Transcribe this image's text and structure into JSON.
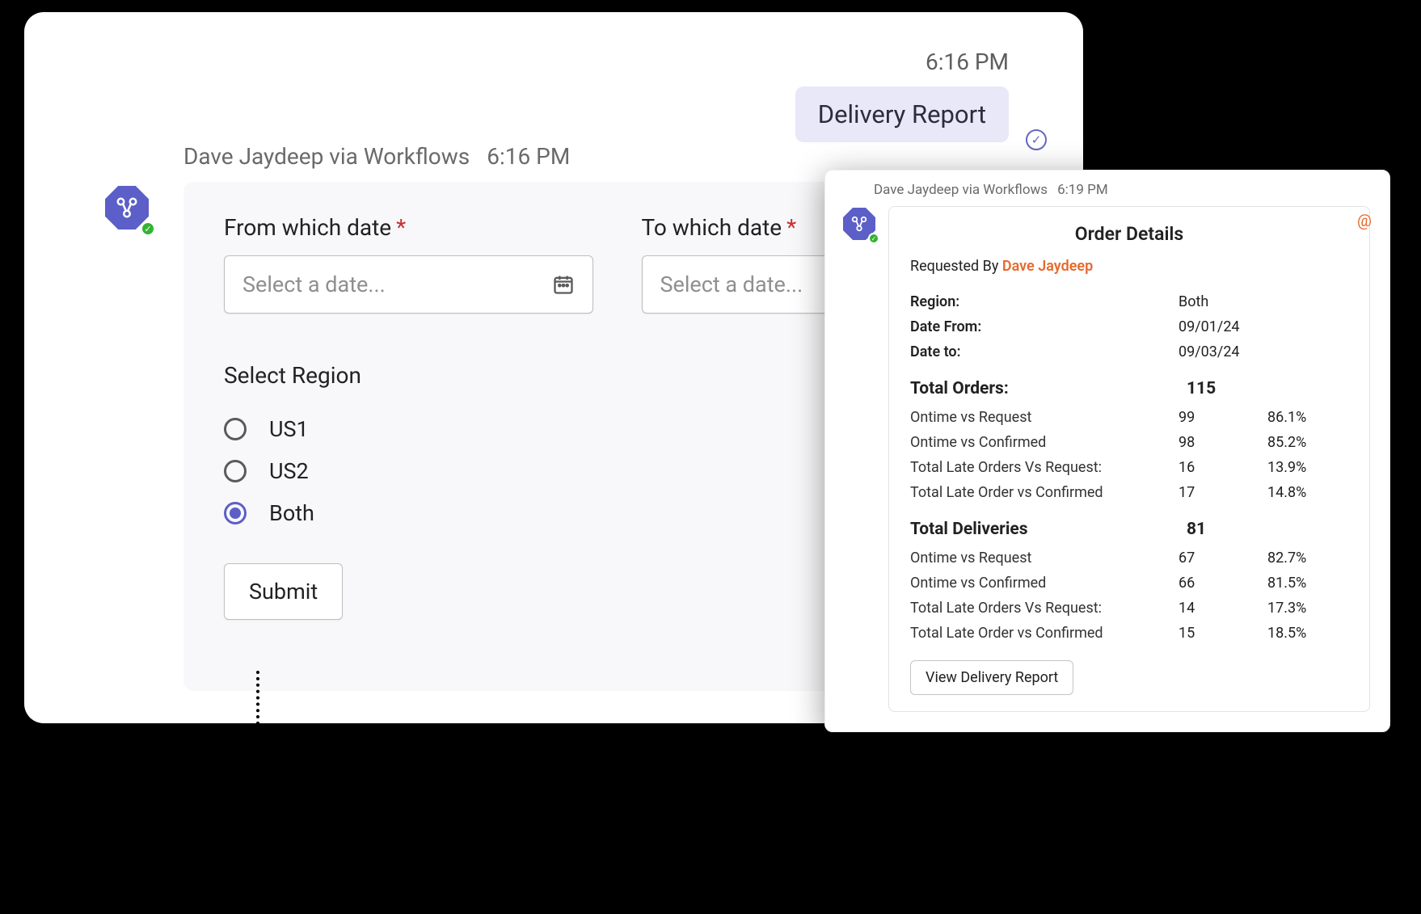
{
  "card1": {
    "timestampTop": "6:16 PM",
    "pillLabel": "Delivery Report",
    "senderName": "Dave Jaydeep via Workflows",
    "senderTime": "6:16 PM",
    "form": {
      "fromLabel": "From which date",
      "toLabel": "To which date",
      "placeholder": "Select a date...",
      "regionLabel": "Select Region",
      "regionOptions": [
        "US1",
        "US2",
        "Both"
      ],
      "regionSelected": "Both",
      "submitLabel": "Submit"
    }
  },
  "card2": {
    "senderName": "Dave Jaydeep via Workflows",
    "senderTime": "6:19 PM",
    "title": "Order Details",
    "requestedByLabel": "Requested By",
    "requestedByName": "Dave Jaydeep",
    "meta": [
      {
        "k": "Region:",
        "v": "Both"
      },
      {
        "k": "Date From:",
        "v": "09/01/24"
      },
      {
        "k": "Date to:",
        "v": "09/03/24"
      }
    ],
    "sections": [
      {
        "title": "Total Orders:",
        "total": "115",
        "rows": [
          {
            "label": "Ontime vs Request",
            "count": "99",
            "pct": "86.1%"
          },
          {
            "label": "Ontime vs Confirmed",
            "count": "98",
            "pct": "85.2%"
          },
          {
            "label": "Total Late Orders Vs Request:",
            "count": "16",
            "pct": "13.9%"
          },
          {
            "label": "Total Late Order vs Confirmed",
            "count": "17",
            "pct": "14.8%"
          }
        ]
      },
      {
        "title": "Total Deliveries",
        "total": "81",
        "rows": [
          {
            "label": "Ontime vs Request",
            "count": "67",
            "pct": "82.7%"
          },
          {
            "label": "Ontime vs Confirmed",
            "count": "66",
            "pct": "81.5%"
          },
          {
            "label": "Total Late Orders Vs Request:",
            "count": "14",
            "pct": "17.3%"
          },
          {
            "label": "Total Late Order vs Confirmed",
            "count": "15",
            "pct": "18.5%"
          }
        ]
      }
    ],
    "viewBtn": "View Delivery Report"
  }
}
